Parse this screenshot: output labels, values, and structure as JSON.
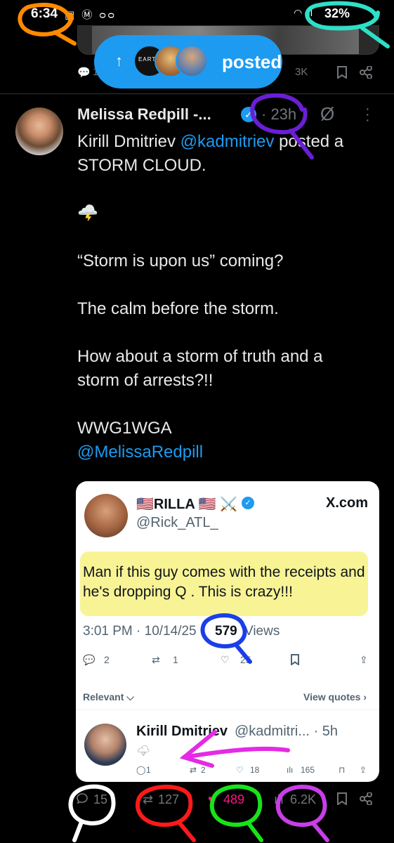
{
  "status_bar": {
    "time": "6:34",
    "left_icons": "▣ Ⓜ ᴑᴑ",
    "right_icons": "◠ .ıl",
    "battery": "32%"
  },
  "previous_tweet": {
    "replies_partial": "1",
    "views_partial": "3K"
  },
  "posted_pill": {
    "avatar_1_text": "EARTH",
    "label": "posted"
  },
  "tweet": {
    "author_name": "Melissa Redpill -...",
    "time": "· 23h",
    "lines": [
      {
        "pre": "Kirill Dmitriev ",
        "mention": "@kadmitriev",
        "post": " posted a"
      },
      {
        "text": "STORM CLOUD."
      },
      {
        "text": ""
      },
      {
        "text": "🌩️"
      },
      {
        "text": ""
      },
      {
        "text": "“Storm is upon us” coming?"
      },
      {
        "text": ""
      },
      {
        "text": "The calm before the storm."
      },
      {
        "text": ""
      },
      {
        "text": "How about a storm of truth and a"
      },
      {
        "text": "storm of arrests?!!"
      },
      {
        "text": ""
      },
      {
        "text": "WWG1WGA"
      }
    ],
    "signature_mention": "@MelissaRedpill",
    "stats": {
      "replies": "15",
      "retweets": "127",
      "likes": "489",
      "views": "6.2K"
    }
  },
  "quoted_screenshot": {
    "name": "🇺🇸RILLA 🇺🇸 ⚔️",
    "handle": "@Rick_ATL_",
    "source": "X.com",
    "text": "Man if this guy comes with the receipts and he's dropping Q . This is crazy!!!",
    "timestamp": "3:01 PM · 10/14/25 ·",
    "views_count": "579",
    "views_label": "Views",
    "replies": "2",
    "retweets": "1",
    "likes": "25",
    "relevant_label": "Relevant ⌵",
    "view_quotes_label": "View quotes ›",
    "reply": {
      "name": "Kirill Dmitriev",
      "handle_time": "@kadmitri... · 5h",
      "replies": "1",
      "retweets": "2",
      "likes": "18",
      "views": "165"
    }
  },
  "colors": {
    "background": "#000000",
    "accent": "#1d9bf0",
    "text_primary": "#e7e9ea",
    "text_secondary": "#71767b",
    "annot_orange": "#ff8a00",
    "annot_teal": "#2de0c8",
    "annot_purple": "#6a1fd6",
    "annot_blue": "#1a3fe8",
    "annot_magenta": "#e52ae5",
    "annot_white": "#ffffff",
    "annot_red": "#ff1a1a",
    "annot_green": "#18e318",
    "annot_violet": "#c83ee8"
  }
}
